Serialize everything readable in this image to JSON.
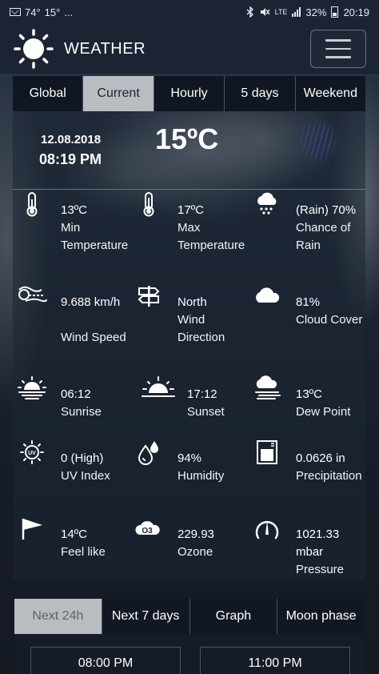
{
  "status_bar": {
    "temp_small_1": "74°",
    "temp_small_2": "15°",
    "dots": "...",
    "network": "LTE",
    "battery": "32%",
    "time": "20:19"
  },
  "app_bar": {
    "title": "WEATHER"
  },
  "top_tabs": [
    {
      "label": "Global",
      "active": false
    },
    {
      "label": "Current",
      "active": true
    },
    {
      "label": "Hourly",
      "active": false
    },
    {
      "label": "5 days",
      "active": false
    },
    {
      "label": "Weekend",
      "active": false
    }
  ],
  "current": {
    "date": "12.08.2018",
    "time": "08:19 PM",
    "temperature": "15ºC"
  },
  "metrics": [
    {
      "icon": "thermometer-icon",
      "value": "13ºC",
      "label": "Min Temperature"
    },
    {
      "icon": "thermometer-icon",
      "value": "17ºC",
      "label": "Max Temperature"
    },
    {
      "icon": "rain-cloud-icon",
      "value": "(Rain) 70%",
      "label": "Chance of Rain"
    },
    {
      "icon": "wind-icon",
      "value": "9.688 km/h",
      "label": "Wind Speed"
    },
    {
      "icon": "signpost-icon",
      "value": "North",
      "label": "Wind Direction"
    },
    {
      "icon": "cloud-icon",
      "value": "81%",
      "label": "Cloud Cover"
    },
    {
      "icon": "sunrise-icon",
      "value": "06:12",
      "label": "Sunrise"
    },
    {
      "icon": "sunset-icon",
      "value": "17:12",
      "label": "Sunset"
    },
    {
      "icon": "fog-cloud-icon",
      "value": "13ºC",
      "label": "Dew Point"
    },
    {
      "icon": "uv-sun-icon",
      "value": "0 (High)",
      "label": "UV Index"
    },
    {
      "icon": "droplets-icon",
      "value": "94%",
      "label": "Humidity"
    },
    {
      "icon": "rain-gauge-icon",
      "value": "0.0626 in",
      "label": "Precipitation"
    },
    {
      "icon": "flag-icon",
      "value": "14ºC",
      "label": "Feel like"
    },
    {
      "icon": "ozone-icon",
      "value": "229.93",
      "label": "Ozone"
    },
    {
      "icon": "gauge-icon",
      "value": "1021.33 mbar",
      "label": "Pressure"
    }
  ],
  "bottom_tabs": [
    {
      "label": "Next 24h",
      "active": true
    },
    {
      "label": "Next 7 days",
      "active": false
    },
    {
      "label": "Graph",
      "active": false
    },
    {
      "label": "Moon phase",
      "active": false
    }
  ],
  "hourly": [
    {
      "time": "08:00 PM"
    },
    {
      "time": "11:00 PM"
    }
  ],
  "colors": {
    "app_bar": "#1c2434",
    "active_tab": "#b9bcc1",
    "text": "#ffffff"
  }
}
